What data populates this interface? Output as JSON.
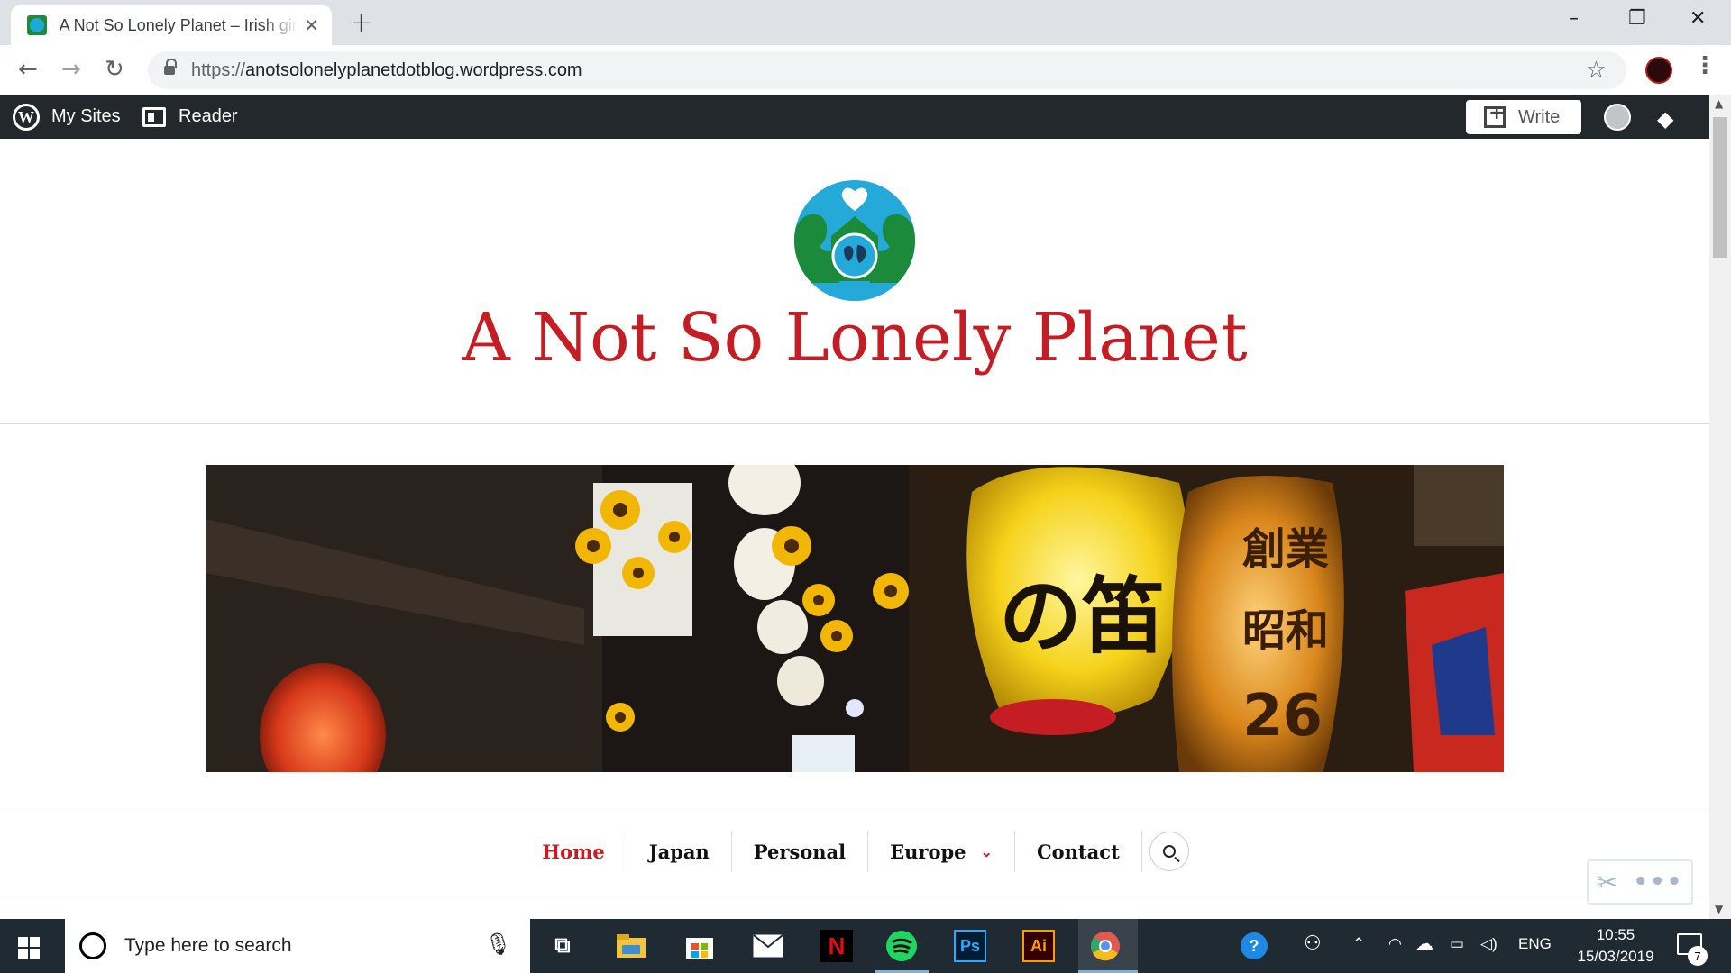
{
  "browser": {
    "tab_title": "A Not So Lonely Planet – Irish girl",
    "new_tab_symbol": "+",
    "close_symbol": "✕",
    "url_scheme": "https://",
    "url_host": "anotsolonelyplanetdotblog.wordpress.com",
    "window_controls": [
      "–",
      "❐",
      "✕"
    ]
  },
  "admin_bar": {
    "my_sites": "My Sites",
    "reader": "Reader",
    "write": "Write"
  },
  "site": {
    "title": "A Not So Lonely Planet",
    "nav": [
      {
        "label": "Home",
        "active": true
      },
      {
        "label": "Japan"
      },
      {
        "label": "Personal"
      },
      {
        "label": "Europe",
        "has_submenu": true
      },
      {
        "label": "Contact"
      }
    ],
    "colors": {
      "accent": "#c41e24",
      "logo_blue": "#25a9d9",
      "logo_green": "#1b8a3a"
    }
  },
  "taskbar": {
    "search_placeholder": "Type here to search",
    "language": "ENG",
    "time": "10:55",
    "date": "15/03/2019",
    "notification_count": "7",
    "apps": [
      "task-view",
      "file-explorer",
      "store",
      "mail",
      "netflix",
      "spotify",
      "photoshop",
      "illustrator",
      "chrome"
    ],
    "app_labels": {
      "netflix": "N",
      "photoshop": "Ps",
      "illustrator": "Ai"
    }
  }
}
